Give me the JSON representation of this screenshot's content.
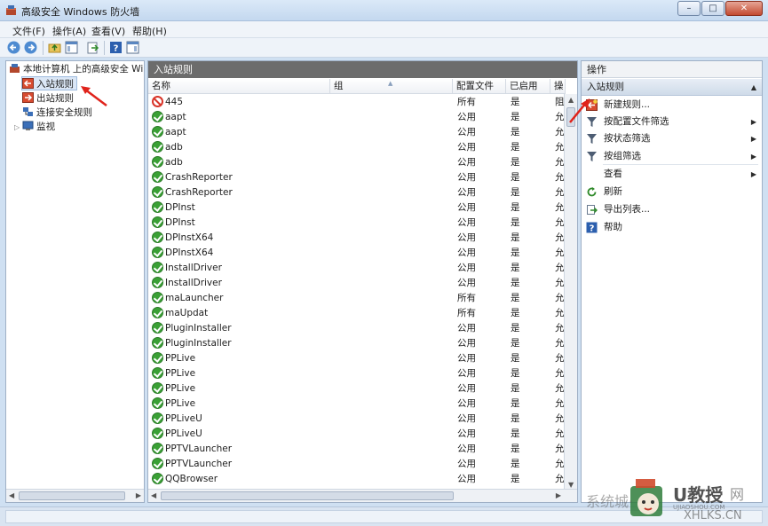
{
  "window": {
    "title": "高级安全 Windows 防火墙",
    "controls": [
      "–",
      "□",
      "✕"
    ]
  },
  "menu": [
    "文件(F)",
    "操作(A)",
    "查看(V)",
    "帮助(H)"
  ],
  "tree": {
    "root": "本地计算机 上的高级安全 Wind",
    "items": [
      "入站规则",
      "出站规则",
      "连接安全规则",
      "监视"
    ]
  },
  "center": {
    "header": "入站规则",
    "columns": [
      "名称",
      "组",
      "配置文件",
      "已启用",
      "操"
    ],
    "rules": [
      {
        "name": "445",
        "status": "deny",
        "profile": "所有",
        "enabled": "是",
        "action": "阻"
      },
      {
        "name": "aapt",
        "status": "ok",
        "profile": "公用",
        "enabled": "是",
        "action": "允"
      },
      {
        "name": "aapt",
        "status": "ok",
        "profile": "公用",
        "enabled": "是",
        "action": "允"
      },
      {
        "name": "adb",
        "status": "ok",
        "profile": "公用",
        "enabled": "是",
        "action": "允"
      },
      {
        "name": "adb",
        "status": "ok",
        "profile": "公用",
        "enabled": "是",
        "action": "允"
      },
      {
        "name": "CrashReporter",
        "status": "ok",
        "profile": "公用",
        "enabled": "是",
        "action": "允"
      },
      {
        "name": "CrashReporter",
        "status": "ok",
        "profile": "公用",
        "enabled": "是",
        "action": "允"
      },
      {
        "name": "DPInst",
        "status": "ok",
        "profile": "公用",
        "enabled": "是",
        "action": "允"
      },
      {
        "name": "DPInst",
        "status": "ok",
        "profile": "公用",
        "enabled": "是",
        "action": "允"
      },
      {
        "name": "DPInstX64",
        "status": "ok",
        "profile": "公用",
        "enabled": "是",
        "action": "允"
      },
      {
        "name": "DPInstX64",
        "status": "ok",
        "profile": "公用",
        "enabled": "是",
        "action": "允"
      },
      {
        "name": "InstallDriver",
        "status": "ok",
        "profile": "公用",
        "enabled": "是",
        "action": "允"
      },
      {
        "name": "InstallDriver",
        "status": "ok",
        "profile": "公用",
        "enabled": "是",
        "action": "允"
      },
      {
        "name": "maLauncher",
        "status": "ok",
        "profile": "所有",
        "enabled": "是",
        "action": "允"
      },
      {
        "name": "maUpdat",
        "status": "ok",
        "profile": "所有",
        "enabled": "是",
        "action": "允"
      },
      {
        "name": "PluginInstaller",
        "status": "ok",
        "profile": "公用",
        "enabled": "是",
        "action": "允"
      },
      {
        "name": "PluginInstaller",
        "status": "ok",
        "profile": "公用",
        "enabled": "是",
        "action": "允"
      },
      {
        "name": "PPLive",
        "status": "ok",
        "profile": "公用",
        "enabled": "是",
        "action": "允"
      },
      {
        "name": "PPLive",
        "status": "ok",
        "profile": "公用",
        "enabled": "是",
        "action": "允"
      },
      {
        "name": "PPLive",
        "status": "ok",
        "profile": "公用",
        "enabled": "是",
        "action": "允"
      },
      {
        "name": "PPLive",
        "status": "ok",
        "profile": "公用",
        "enabled": "是",
        "action": "允"
      },
      {
        "name": "PPLiveU",
        "status": "ok",
        "profile": "公用",
        "enabled": "是",
        "action": "允"
      },
      {
        "name": "PPLiveU",
        "status": "ok",
        "profile": "公用",
        "enabled": "是",
        "action": "允"
      },
      {
        "name": "PPTVLauncher",
        "status": "ok",
        "profile": "公用",
        "enabled": "是",
        "action": "允"
      },
      {
        "name": "PPTVLauncher",
        "status": "ok",
        "profile": "公用",
        "enabled": "是",
        "action": "允"
      },
      {
        "name": "QQBrowser",
        "status": "ok",
        "profile": "公用",
        "enabled": "是",
        "action": "允"
      }
    ]
  },
  "actions": {
    "header": "操作",
    "section": "入站规则",
    "items": [
      {
        "label": "新建规则...",
        "icon": "new-rule-icon",
        "submenu": false
      },
      {
        "label": "按配置文件筛选",
        "icon": "filter-icon",
        "submenu": true
      },
      {
        "label": "按状态筛选",
        "icon": "filter-icon",
        "submenu": true
      },
      {
        "label": "按组筛选",
        "icon": "filter-icon",
        "submenu": true
      },
      {
        "label": "查看",
        "icon": "",
        "submenu": true
      },
      {
        "label": "刷新",
        "icon": "refresh-icon",
        "submenu": false
      },
      {
        "label": "导出列表...",
        "icon": "export-icon",
        "submenu": false
      },
      {
        "label": "帮助",
        "icon": "help-icon",
        "submenu": false
      }
    ]
  },
  "watermark": {
    "site_a": "U教授",
    "site_a_url": "UJIAOSHOU.COM",
    "site_b": "系统城·",
    "site_b_url": "XHLKS.CN",
    "extra": "网"
  },
  "colors": {
    "accent_header": "#6c6c6c",
    "allow_green": "#3aa035",
    "deny_red": "#d8352a",
    "annotation_red": "#e0231b"
  }
}
